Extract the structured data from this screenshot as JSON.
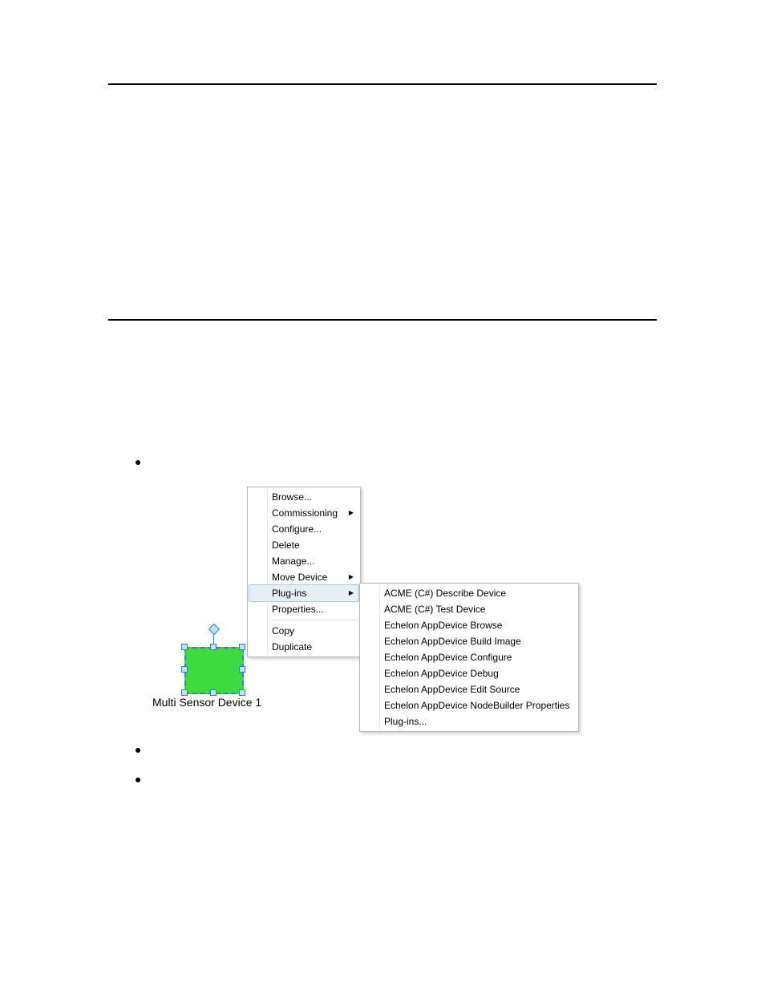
{
  "device": {
    "label": "Multi Sensor Device 1"
  },
  "context_menu": {
    "items": [
      {
        "label": "Browse...",
        "submenu": false
      },
      {
        "label": "Commissioning",
        "submenu": true
      },
      {
        "label": "Configure...",
        "submenu": false
      },
      {
        "label": "Delete",
        "submenu": false
      },
      {
        "label": "Manage...",
        "submenu": false
      },
      {
        "label": "Move Device",
        "submenu": true
      },
      {
        "label": "Plug-ins",
        "submenu": true,
        "highlight": true
      },
      {
        "label": "Properties...",
        "submenu": false
      }
    ],
    "items2": [
      {
        "label": "Copy"
      },
      {
        "label": "Duplicate"
      }
    ]
  },
  "submenu": {
    "items": [
      {
        "label": "ACME (C#) Describe Device"
      },
      {
        "label": "ACME (C#) Test Device"
      },
      {
        "label": "Echelon AppDevice Browse"
      },
      {
        "label": "Echelon AppDevice Build Image"
      },
      {
        "label": "Echelon AppDevice Configure"
      },
      {
        "label": "Echelon AppDevice Debug"
      },
      {
        "label": "Echelon AppDevice Edit Source"
      },
      {
        "label": "Echelon AppDevice NodeBuilder Properties"
      },
      {
        "label": "Plug-ins..."
      }
    ]
  }
}
